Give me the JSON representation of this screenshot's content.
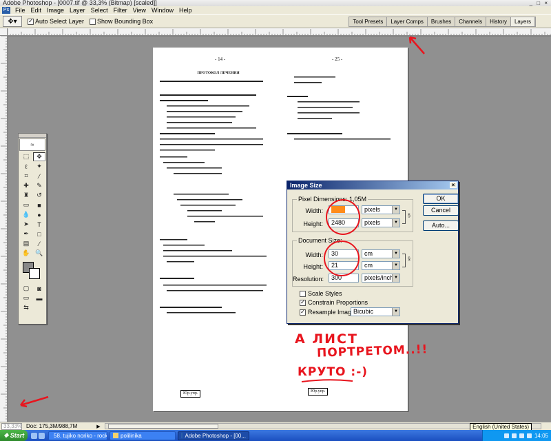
{
  "window": {
    "title": "Adobe Photoshop - [0007.tif @ 33,3% (Bitmap) [scaled]]",
    "controls": "_ □ ×"
  },
  "menu": [
    "File",
    "Edit",
    "Image",
    "Layer",
    "Select",
    "Filter",
    "View",
    "Window",
    "Help"
  ],
  "options_bar": {
    "auto_select_layer": "Auto Select Layer",
    "show_bounding_box": "Show Bounding Box",
    "palette_wells": [
      "Tool Presets",
      "Layer Comps",
      "Brushes",
      "Channels",
      "History",
      "Layers"
    ]
  },
  "dialog": {
    "title": "Image Size",
    "pixel_dimensions_label": "Pixel Dimensions: 1,05M",
    "width_label": "Width:",
    "height_label": "Height:",
    "pixel_width": "3543",
    "pixel_height": "2480",
    "pixel_unit": "pixels",
    "document_size_label": "Document Size:",
    "doc_width": "30",
    "doc_height": "21",
    "doc_unit": "cm",
    "resolution_label": "Resolution:",
    "resolution": "300",
    "resolution_unit": "pixels/inch",
    "scale_styles": "Scale Styles",
    "constrain_proportions": "Constrain Proportions",
    "resample_image": "Resample Image:",
    "resample_method": "Bicubic",
    "ok": "OK",
    "cancel": "Cancel",
    "auto": "Auto...",
    "scale_styles_checked": false,
    "constrain_checked": true,
    "resample_checked": true
  },
  "annotation": {
    "line1": "А ЛИСТ",
    "line2": "ПОРТРЕТОМ..!!",
    "line3": "КРУТО :-)",
    "color": "#e8151e"
  },
  "status_bar": {
    "zoom": "33,33%",
    "doc_sizes": "Doc: 175,3M/988,7M",
    "tooltip": "English (United States)"
  },
  "taskbar": {
    "start": "Start",
    "tasks": [
      "58. tujiko noriko - rocket ...",
      "polilinika",
      "Adobe Photoshop - [00..."
    ],
    "clock": "14:05"
  },
  "document": {
    "left_page_number": "- 14 -",
    "right_page_number": "- 25 -",
    "heading": "ПРОТОКОЛ ЛЕЧЕНИЯ",
    "left_box": "Юр.упр.",
    "right_box": "Юр.упр."
  }
}
